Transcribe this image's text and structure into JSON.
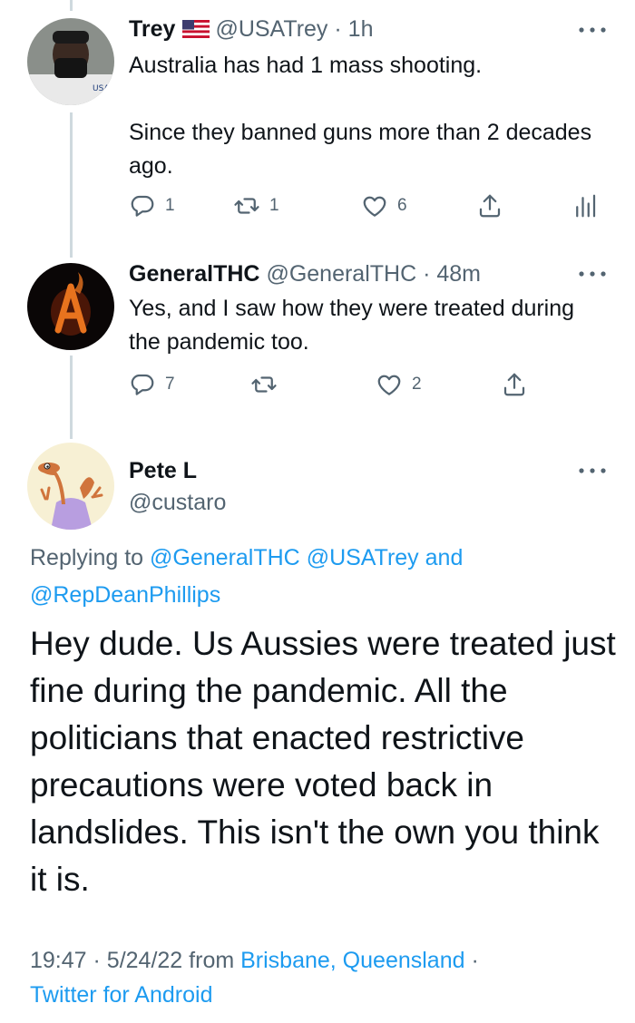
{
  "tweets": [
    {
      "name": "Trey",
      "handle": "@USATrey",
      "dot": "·",
      "time": "1h",
      "text": "Australia has had 1 mass shooting.\n\nSince they banned guns more than 2 decades ago.",
      "replies": "1",
      "retweets": "1",
      "likes": "6"
    },
    {
      "name": "GeneralTHC",
      "handle": "@GeneralTHC",
      "dot": "·",
      "time": "48m",
      "text": "Yes, and I saw how they were treated during the pandemic too.",
      "replies": "7",
      "retweets": "",
      "likes": "2"
    }
  ],
  "main_tweet": {
    "name": "Pete L",
    "handle": "@custaro",
    "replying_prefix": "Replying to",
    "replying_handles": [
      "@GeneralTHC",
      "@USATrey"
    ],
    "replying_and": "and",
    "replying_last": "@RepDeanPhillips",
    "text": "Hey dude. Us Aussies were treated just fine during the pandemic. All the politicians that enacted restrictive precautions were voted back in landslides. This isn't the own you think it is.",
    "time": "19:47",
    "dot": "·",
    "date": "5/24/22",
    "from_label": "from",
    "location": "Brisbane, Queensland",
    "client": "Twitter for Android"
  },
  "colors": {
    "text": "#0f1419",
    "secondary": "#536471",
    "link": "#1d9bf0",
    "thread_line": "#cfd9de"
  },
  "icons": [
    "more-icon",
    "reply-icon",
    "retweet-icon",
    "like-icon",
    "share-icon",
    "analytics-icon",
    "us-flag-icon"
  ]
}
